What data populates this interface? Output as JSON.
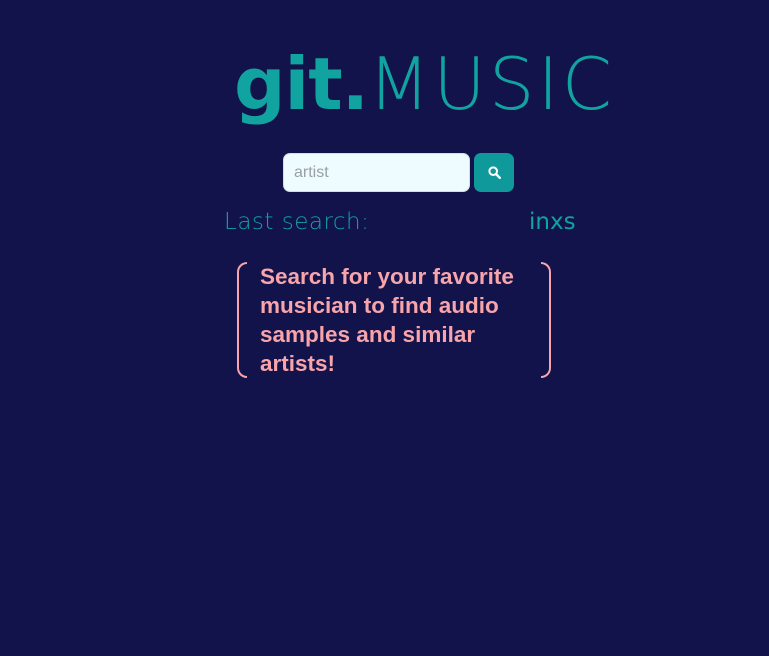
{
  "logo": {
    "part1": "git.",
    "part2": "MUSIC"
  },
  "search": {
    "placeholder": "artist",
    "value": "",
    "button_icon": "search-icon"
  },
  "last_search": {
    "label": "Last search:",
    "value": "inxs"
  },
  "prompt": {
    "text": "Search for your favorite musician to find audio samples and similar artists!"
  },
  "colors": {
    "background": "#13134b",
    "accent": "#10a3a0",
    "button": "#10999a",
    "prompt": "#f7a4ab",
    "input_bg": "#eefbff"
  }
}
